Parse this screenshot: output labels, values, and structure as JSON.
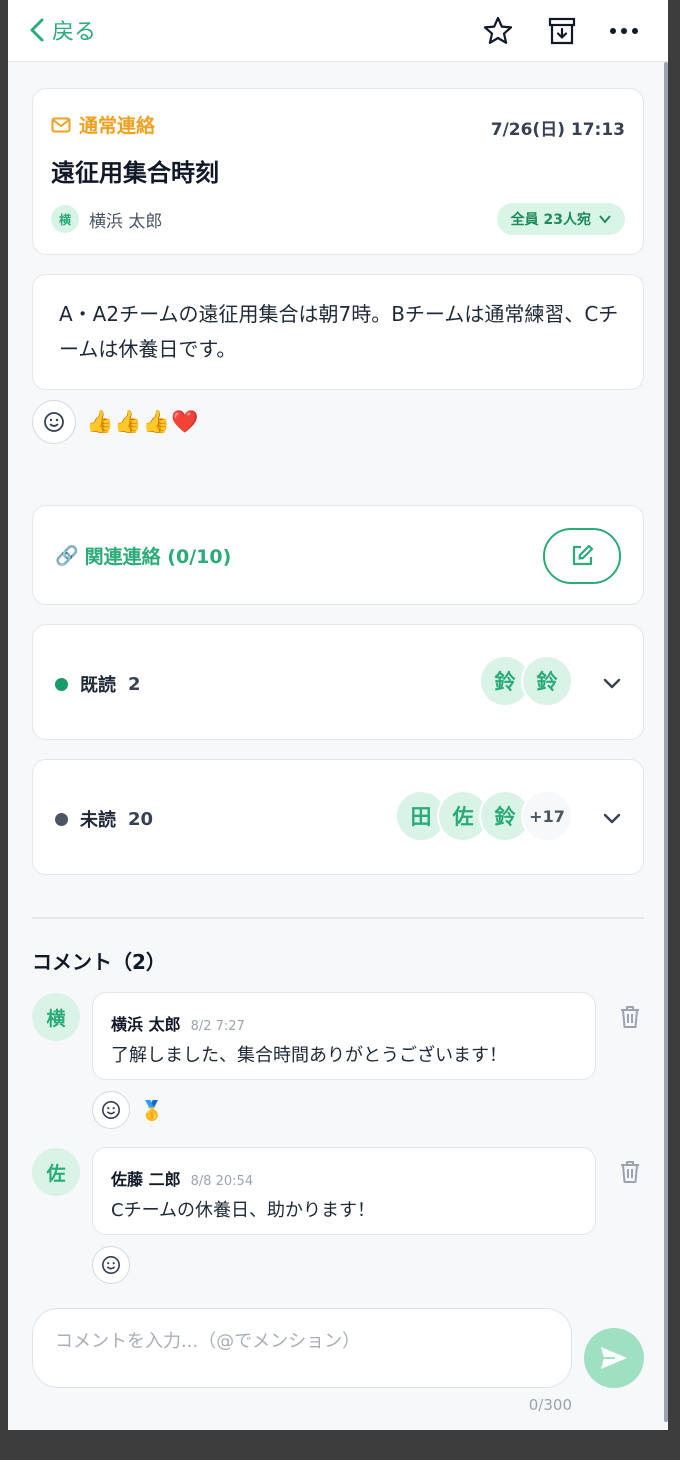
{
  "topbar": {
    "back_label": "戻る",
    "icons": [
      "star-icon",
      "archive-icon",
      "more-icon"
    ]
  },
  "message": {
    "category": "通常連絡",
    "date": "7/26(日) 17:13",
    "title": "遠征用集合時刻",
    "author_initial": "横",
    "author_name": "横浜 太郎",
    "recipients": "全員 23人宛",
    "body": "A・A2チームの遠征用集合は朝7時。Bチームは通常練習、Cチームは休養日です。",
    "reactions": "👍👍👍❤️"
  },
  "related": {
    "icon": "🔗",
    "label": "関連連絡 (0/10)"
  },
  "read": {
    "label": "既読",
    "count": "2",
    "avatars": [
      "鈴",
      "鈴"
    ],
    "color": "#1a9a6a"
  },
  "unread": {
    "label": "未読",
    "count": "20",
    "avatars": [
      "田",
      "佐",
      "鈴"
    ],
    "more": "+17",
    "color": "#4b5563"
  },
  "comments": {
    "heading": "コメント（2）",
    "items": [
      {
        "initial": "横",
        "name": "横浜 太郎",
        "time": "8/2 7:27",
        "text": "了解しました、集合時間ありがとうございます！",
        "reactions": "🥇"
      },
      {
        "initial": "佐",
        "name": "佐藤 二郎",
        "time": "8/8 20:54",
        "text": "Cチームの休養日、助かります！",
        "reactions": ""
      }
    ]
  },
  "composer": {
    "placeholder": "コメントを入力...（@でメンション）",
    "counter": "0/300"
  },
  "colors": {
    "accent": "#2bab78",
    "category": "#f0a020"
  }
}
